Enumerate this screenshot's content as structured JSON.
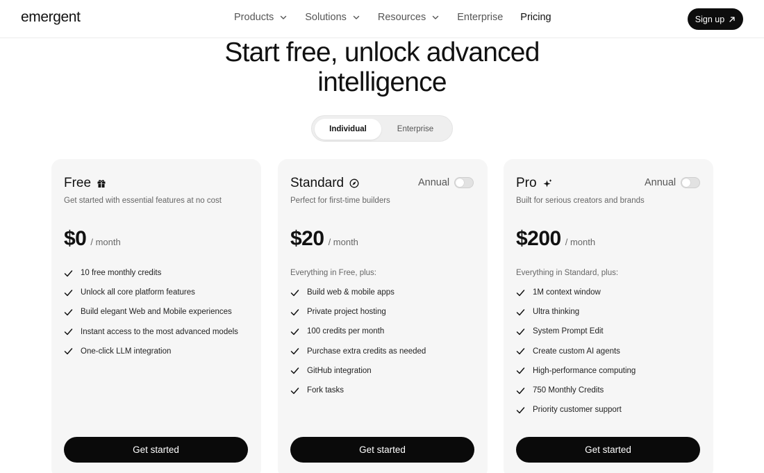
{
  "nav": {
    "logo": "emergent",
    "links": [
      {
        "label": "Products",
        "dropdown": true
      },
      {
        "label": "Solutions",
        "dropdown": true
      },
      {
        "label": "Resources",
        "dropdown": true
      },
      {
        "label": "Enterprise",
        "dropdown": false
      },
      {
        "label": "Pricing",
        "dropdown": false
      }
    ],
    "signup_label": "Sign up"
  },
  "hero": {
    "line1": "Start free, unlock advanced",
    "line2": "intelligence"
  },
  "plan_toggle": {
    "options": [
      "Individual",
      "Enterprise"
    ],
    "selected": "Individual"
  },
  "plans": [
    {
      "name": "Free",
      "icon": "gift-icon",
      "annual_label": "",
      "description": "Get started with essential features at no cost",
      "price": "$0",
      "period": "/ month",
      "includes": "",
      "features": [
        "10 free monthly credits",
        "Unlock all core platform features",
        "Build elegant Web and Mobile experiences",
        "Instant access to the most advanced models",
        "One-click LLM integration"
      ],
      "cta": "Get started"
    },
    {
      "name": "Standard",
      "icon": "compass-icon",
      "annual_label": "Annual",
      "annual_on": false,
      "description": "Perfect for first-time builders",
      "price": "$20",
      "period": "/ month",
      "includes": "Everything in Free, plus:",
      "features": [
        "Build web & mobile apps",
        "Private project hosting",
        "100 credits per month",
        "Purchase extra credits as needed",
        "GitHub integration",
        "Fork tasks"
      ],
      "cta": "Get started"
    },
    {
      "name": "Pro",
      "icon": "sparkle-icon",
      "annual_label": "Annual",
      "annual_on": false,
      "description": "Built for serious creators and brands",
      "price": "$200",
      "period": "/ month",
      "includes": "Everything in Standard, plus:",
      "features": [
        "1M context window",
        "Ultra thinking",
        "System Prompt Edit",
        "Create custom AI agents",
        "High-performance computing",
        "750 Monthly Credits",
        "Priority customer support"
      ],
      "cta": "Get started"
    }
  ],
  "colors": {
    "card_bg": "#f6f6f6",
    "button_bg": "#0a0a0a",
    "muted_text": "#666666"
  }
}
